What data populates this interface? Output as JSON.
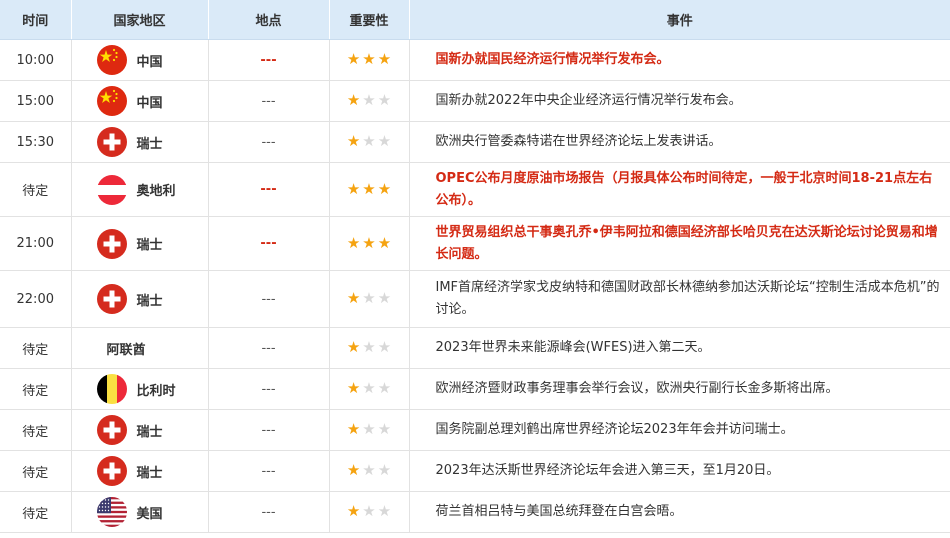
{
  "header": {
    "time": "时间",
    "country": "国家地区",
    "location": "地点",
    "importance": "重要性",
    "event": "事件"
  },
  "rows": [
    {
      "time": "10:00",
      "country": "中国",
      "flag": "cn",
      "location": "---",
      "stars": 3,
      "event": "国新办就国民经济运行情况举行发布会。",
      "highlight": true
    },
    {
      "time": "15:00",
      "country": "中国",
      "flag": "cn",
      "location": "---",
      "stars": 1,
      "event": "国新办就2022年中央企业经济运行情况举行发布会。",
      "highlight": false
    },
    {
      "time": "15:30",
      "country": "瑞士",
      "flag": "ch",
      "location": "---",
      "stars": 1,
      "event": "欧洲央行管委森特诺在世界经济论坛上发表讲话。",
      "highlight": false
    },
    {
      "time": "待定",
      "country": "奥地利",
      "flag": "at",
      "location": "---",
      "stars": 3,
      "event": "OPEC公布月度原油市场报告（月报具体公布时间待定，一般于北京时间18-21点左右公布）。",
      "highlight": true
    },
    {
      "time": "21:00",
      "country": "瑞士",
      "flag": "ch",
      "location": "---",
      "stars": 3,
      "event": "世界贸易组织总干事奥孔乔•伊韦阿拉和德国经济部长哈贝克在达沃斯论坛讨论贸易和增长问题。",
      "highlight": true
    },
    {
      "time": "22:00",
      "country": "瑞士",
      "flag": "ch",
      "location": "---",
      "stars": 1,
      "event": "IMF首席经济学家戈皮纳特和德国财政部长林德纳参加达沃斯论坛“控制生活成本危机”的讨论。",
      "highlight": false
    },
    {
      "time": "待定",
      "country": "阿联酋",
      "flag": "",
      "location": "---",
      "stars": 1,
      "event": "2023年世界未来能源峰会(WFES)进入第二天。",
      "highlight": false
    },
    {
      "time": "待定",
      "country": "比利时",
      "flag": "be",
      "location": "---",
      "stars": 1,
      "event": "欧洲经济暨财政事务理事会举行会议，欧洲央行副行长金多斯将出席。",
      "highlight": false
    },
    {
      "time": "待定",
      "country": "瑞士",
      "flag": "ch",
      "location": "---",
      "stars": 1,
      "event": "国务院副总理刘鹤出席世界经济论坛2023年年会并访问瑞士。",
      "highlight": false
    },
    {
      "time": "待定",
      "country": "瑞士",
      "flag": "ch",
      "location": "---",
      "stars": 1,
      "event": "2023年达沃斯世界经济论坛年会进入第三天，至1月20日。",
      "highlight": false
    },
    {
      "time": "待定",
      "country": "美国",
      "flag": "us",
      "location": "---",
      "stars": 1,
      "event": "荷兰首相吕特与美国总统拜登在白宫会晤。",
      "highlight": false
    }
  ],
  "colors": {
    "accent_red": "#d42a14",
    "star_on": "#f5a311",
    "star_off": "#d8d8d8",
    "header_bg": "#daeaf8"
  }
}
